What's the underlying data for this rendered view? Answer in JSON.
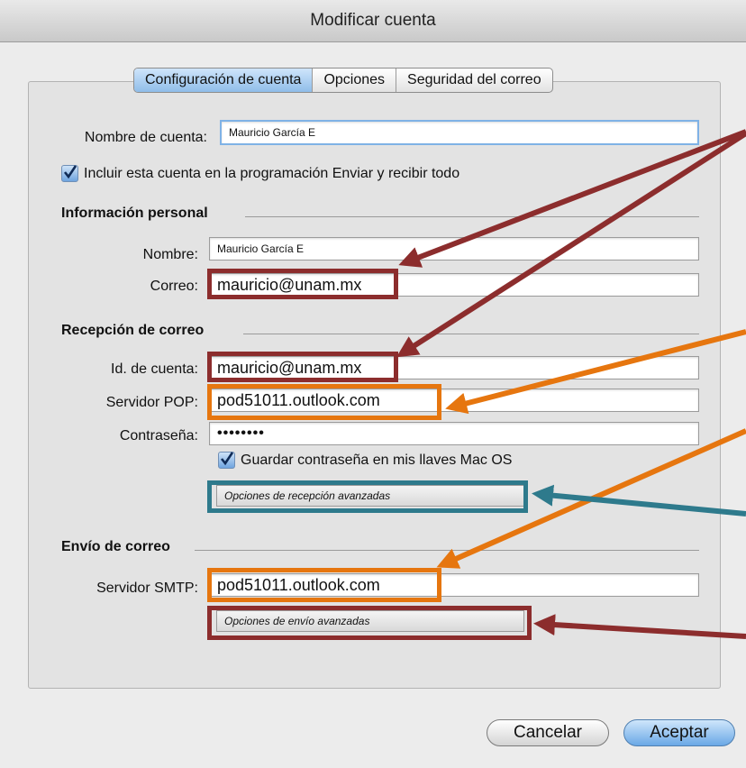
{
  "window": {
    "title": "Modificar cuenta"
  },
  "tabs": [
    "Configuración de cuenta",
    "Opciones",
    "Seguridad del correo"
  ],
  "account": {
    "name_label": "Nombre de cuenta:",
    "name_value": "Mauricio García E",
    "include_label": "Incluir esta cuenta en la programación Enviar y recibir todo",
    "include_checked": true
  },
  "personal": {
    "section": "Información personal",
    "nombre_label": "Nombre:",
    "nombre_value": "Mauricio García E",
    "correo_label": "Correo:",
    "correo_value": "mauricio@unam.mx"
  },
  "incoming": {
    "section": "Recepción de correo",
    "id_label": "Id. de cuenta:",
    "id_value": "mauricio@unam.mx",
    "pop_label": "Servidor POP:",
    "pop_value": "pod51011.outlook.com",
    "pass_label": "Contraseña:",
    "pass_value": "••••••••",
    "keychain_label": "Guardar contraseña en mis llaves Mac OS",
    "keychain_checked": true,
    "advanced_label": "Opciones de recepción avanzadas"
  },
  "outgoing": {
    "section": "Envío de correo",
    "smtp_label": "Servidor SMTP:",
    "smtp_value": "pod51011.outlook.com",
    "advanced_label": "Opciones de envío avanzadas"
  },
  "buttons": {
    "cancel": "Cancelar",
    "ok": "Aceptar"
  },
  "annotation_colors": {
    "red": "#8c2d2d",
    "orange": "#e6760f",
    "teal": "#2e7a8c"
  }
}
